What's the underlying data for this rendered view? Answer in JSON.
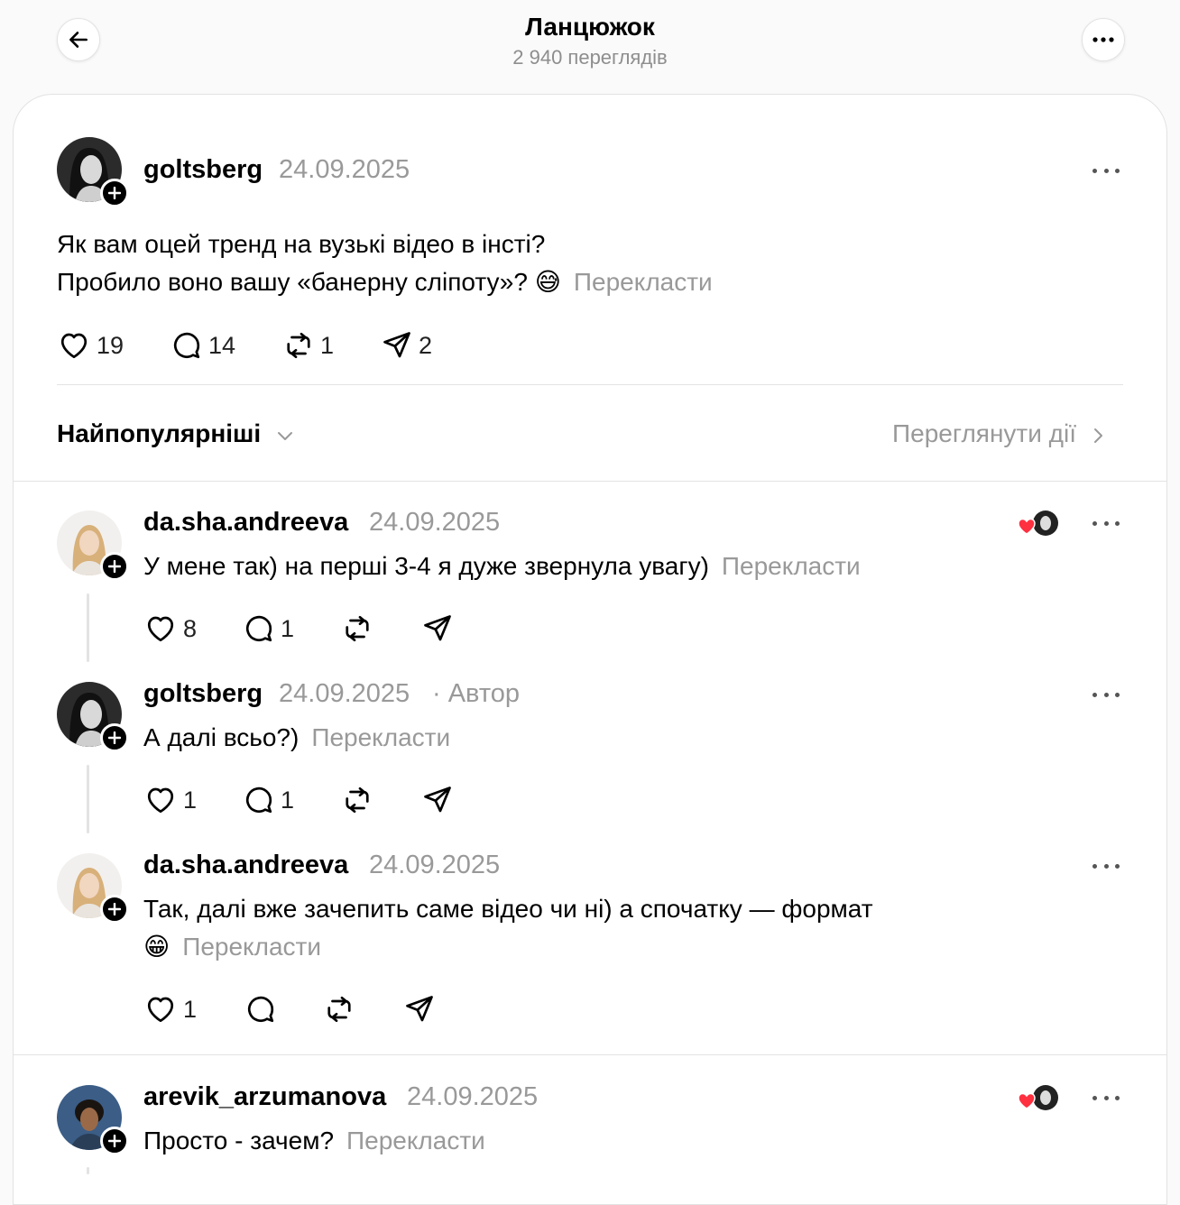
{
  "header": {
    "title": "Ланцюжок",
    "views": "2 940 переглядів"
  },
  "post": {
    "username": "goltsberg",
    "date": "24.09.2025",
    "line1": "Як вам оцей тренд на вузькі відео в інсті?",
    "line2": "Пробило воно вашу «банерну сліпоту»? 😅",
    "translate": "Перекласти",
    "likes": "19",
    "comments": "14",
    "reposts": "1",
    "shares": "2"
  },
  "sort": {
    "label": "Найпопулярніші",
    "activity": "Переглянути дії"
  },
  "replies": [
    {
      "username": "da.sha.andreeva",
      "date": "24.09.2025",
      "text": "У мене так) на перші 3-4 я дуже звернула увагу)",
      "translate": "Перекласти",
      "likes": "8",
      "comments": "1"
    },
    {
      "username": "goltsberg",
      "date": "24.09.2025",
      "author": "· Автор",
      "text": "А далі всьо?)",
      "translate": "Перекласти",
      "likes": "1",
      "comments": "1"
    },
    {
      "username": "da.sha.andreeva",
      "date": "24.09.2025",
      "text": "Так, далі вже зачепить саме відео чи ні) а спочатку — формат",
      "text2": "😁",
      "translate": "Перекласти",
      "likes": "1"
    },
    {
      "username": "arevik_arzumanova",
      "date": "24.09.2025",
      "text": "Просто - зачем?",
      "translate": "Перекласти"
    }
  ],
  "colors": {
    "muted": "#999999",
    "heart": "#ff3040"
  }
}
